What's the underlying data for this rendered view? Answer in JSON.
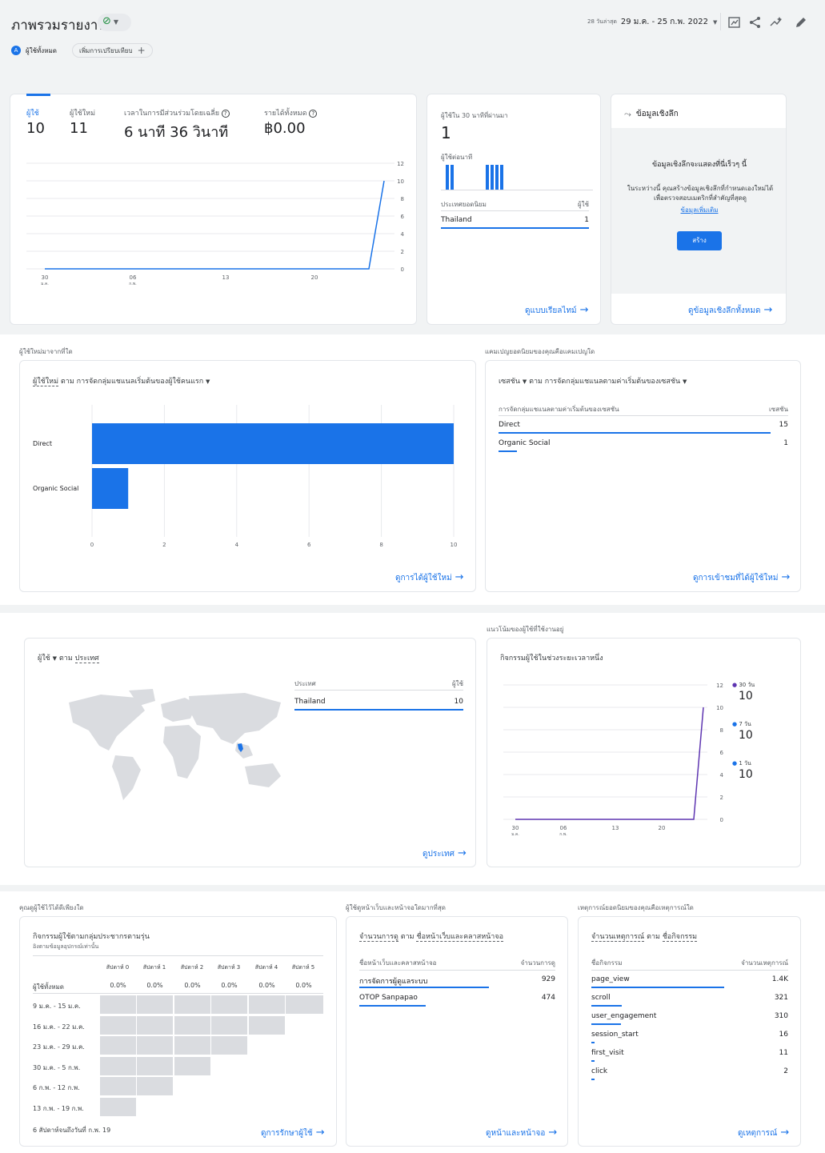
{
  "header": {
    "title": "ภาพรวมรายงาน",
    "date_prefix": "28 วันล่าสุด",
    "date_range": "29 ม.ค. - 25 ก.พ. 2022",
    "all_users_chip": "ผู้ใช้ทั้งหมด",
    "chip_letter": "A",
    "add_compare": "เพิ่มการเปรียบเทียบ"
  },
  "overview": {
    "metrics": [
      {
        "label": "ผู้ใช้",
        "value": "10"
      },
      {
        "label": "ผู้ใช้ใหม่",
        "value": "11"
      },
      {
        "label": "เวลาในการมีส่วนร่วมโดยเฉลี่ย",
        "value": "6 นาที 36 วินาที"
      },
      {
        "label": "รายได้ทั้งหมด",
        "value": "฿0.00"
      }
    ],
    "y_ticks": [
      "12",
      "10",
      "8",
      "6",
      "4",
      "2",
      "0"
    ],
    "x_ticks": [
      {
        "d": "30",
        "m": "ม.ค."
      },
      {
        "d": "06",
        "m": "ก.พ."
      },
      {
        "d": "13",
        "m": ""
      },
      {
        "d": "20",
        "m": ""
      }
    ]
  },
  "realtime": {
    "title": "ผู้ใช้ใน 30 นาทีที่ผ่านมา",
    "value": "1",
    "per_minute": "ผู้ใช้ต่อนาที",
    "col_country": "ประเทศยอดนิยม",
    "col_users": "ผู้ใช้",
    "row_country": "Thailand",
    "row_value": "1",
    "link": "ดูแบบเรียลไทม์"
  },
  "insights": {
    "title": "ข้อมูลเชิงลึก",
    "heading": "ข้อมูลเชิงลึกจะแสดงที่นี่เร็วๆ นี้",
    "body": "ในระหว่างนี้ คุณสร้างข้อมูลเชิงลึกที่กำหนดเองใหม่ได้เพื่อตรวจสอบเมตริกที่สำคัญที่สุดดู",
    "more": "ข้อมูลเพิ่มเติม",
    "button": "สร้าง",
    "link": "ดูข้อมูลเชิงลึกทั้งหมด"
  },
  "new_users": {
    "section": "ผู้ใช้ใหม่มาจากที่ใด",
    "metric": "ผู้ใช้ใหม่",
    "by": "ตาม การจัดกลุ่มแชแนลเริ่มต้นของผู้ใช้คนแรก",
    "link": "ดูการได้ผู้ใช้ใหม่",
    "x_ticks": [
      "0",
      "2",
      "4",
      "6",
      "8",
      "10"
    ]
  },
  "campaigns": {
    "section": "แคมเปญยอดนิยมของคุณคือแคมเปญใด",
    "metric": "เซสชัน",
    "by": "ตาม การจัดกลุ่มแชแนลตามค่าเริ่มต้นของเซสชัน",
    "col_left": "การจัดกลุ่มแชแนลตามค่าเริ่มต้นของเซสชัน",
    "col_right": "เซสชัน",
    "rows": [
      {
        "name": "Direct",
        "value": "15",
        "frac": 1.0
      },
      {
        "name": "Organic Social",
        "value": "1",
        "frac": 0.067
      }
    ],
    "link": "ดูการเข้าชมที่ได้ผู้ใช้ใหม่"
  },
  "countries": {
    "metric": "ผู้ใช้",
    "by": "ตาม",
    "dim": "ประเทศ",
    "col_country": "ประเทศ",
    "col_users": "ผู้ใช้",
    "row_country": "Thailand",
    "row_value": "10",
    "link": "ดูประเทศ"
  },
  "trends": {
    "section": "แนวโน้มของผู้ใช้ที่ใช้งานอยู่",
    "title": "กิจกรรมผู้ใช้ในช่วงระยะเวลาหนึ่ง",
    "y_ticks": [
      "12",
      "10",
      "8",
      "6",
      "4",
      "2",
      "0"
    ],
    "x_ticks": [
      {
        "d": "30",
        "m": "ม.ค."
      },
      {
        "d": "06",
        "m": "ก.พ."
      },
      {
        "d": "13",
        "m": ""
      },
      {
        "d": "20",
        "m": ""
      }
    ],
    "legend": [
      {
        "label": "30 วัน",
        "value": "10",
        "color": "#5e35b1"
      },
      {
        "label": "7 วัน",
        "value": "10",
        "color": "#1a73e8"
      },
      {
        "label": "1 วัน",
        "value": "10",
        "color": "#1a73e8"
      }
    ]
  },
  "retention": {
    "section": "คุณดูผู้ใช้ไว้ได้ดีเพียงใด",
    "title": "กิจกรรมผู้ใช้ตามกลุ่มประชากรตามรุ่น",
    "subtitle": "อิงตามข้อมูลอุปกรณ์เท่านั้น",
    "weeks": [
      "สัปดาห์ 0",
      "สัปดาห์ 1",
      "สัปดาห์ 2",
      "สัปดาห์ 3",
      "สัปดาห์ 4",
      "สัปดาห์ 5"
    ],
    "all_label": "ผู้ใช้ทั้งหมด",
    "all_values": [
      "0.0%",
      "0.0%",
      "0.0%",
      "0.0%",
      "0.0%",
      "0.0%"
    ],
    "cohorts": [
      "9 ม.ค. - 15 ม.ค.",
      "16 ม.ค. - 22 ม.ค.",
      "23 ม.ค. - 29 ม.ค.",
      "30 ม.ค. - 5 ก.พ.",
      "6 ก.พ. - 12 ก.พ.",
      "13 ก.พ. - 19 ก.พ."
    ],
    "footer": "6 สัปดาห์จนถึงวันที่ ก.พ. 19",
    "link": "ดูการรักษาผู้ใช้"
  },
  "pages": {
    "section": "ผู้ใช้ดูหน้าเว็บและหน้าจอใดมากที่สุด",
    "metric": "จำนวนการดู",
    "by": "ตาม",
    "dim": "ชื่อหน้าเว็บและคลาสหน้าจอ",
    "col_left": "ชื่อหน้าเว็บและคลาสหน้าจอ",
    "col_right": "จำนวนการดู",
    "rows": [
      {
        "name": "การจัดการผู้ดูแลระบบ",
        "value": "929",
        "frac": 1.0
      },
      {
        "name": "OTOP Sanpapao",
        "value": "474",
        "frac": 0.51
      }
    ],
    "link": "ดูหน้าและหน้าจอ"
  },
  "events": {
    "section": "เหตุการณ์ยอดนิยมของคุณคือเหตุการณ์ใด",
    "metric": "จำนวนเหตุการณ์",
    "by": "ตาม",
    "dim": "ชื่อกิจกรรม",
    "col_left": "ชื่อกิจกรรม",
    "col_right": "จำนวนเหตุการณ์",
    "rows": [
      {
        "name": "page_view",
        "value": "1.4K",
        "frac": 1.0
      },
      {
        "name": "scroll",
        "value": "321",
        "frac": 0.23
      },
      {
        "name": "user_engagement",
        "value": "310",
        "frac": 0.22
      },
      {
        "name": "session_start",
        "value": "16",
        "frac": 0.012
      },
      {
        "name": "first_visit",
        "value": "11",
        "frac": 0.008
      },
      {
        "name": "click",
        "value": "2",
        "frac": 0.0015
      }
    ],
    "link": "ดูเหตุการณ์"
  },
  "chart_data": [
    {
      "type": "line",
      "title": "ผู้ใช้",
      "x": [
        "30 ม.ค.",
        "06 ก.พ.",
        "13",
        "20",
        "24",
        "25"
      ],
      "series": [
        {
          "name": "ผู้ใช้",
          "values": [
            0,
            0,
            0,
            0,
            0,
            10
          ]
        }
      ],
      "ylim": [
        0,
        12
      ]
    },
    {
      "type": "bar",
      "title": "ผู้ใช้ต่อนาที",
      "categories": [
        "1",
        "2",
        "3",
        "4",
        "5",
        "6",
        "7"
      ],
      "values": [
        1,
        1,
        0,
        1,
        1,
        1,
        1
      ]
    },
    {
      "type": "bar",
      "orientation": "horizontal",
      "title": "ผู้ใช้ใหม่ ตาม การจัดกลุ่มแชแนลเริ่มต้นของผู้ใช้คนแรก",
      "categories": [
        "Direct",
        "Organic Social"
      ],
      "values": [
        10,
        1
      ],
      "xlim": [
        0,
        10
      ]
    },
    {
      "type": "line",
      "title": "กิจกรรมผู้ใช้ในช่วงระยะเวลาหนึ่ง",
      "x": [
        "30 ม.ค.",
        "06 ก.พ.",
        "13",
        "20",
        "24",
        "25"
      ],
      "series": [
        {
          "name": "30 วัน",
          "values": [
            0,
            0,
            0,
            0,
            0,
            10
          ]
        },
        {
          "name": "7 วัน",
          "values": [
            0,
            0,
            0,
            0,
            0,
            10
          ]
        },
        {
          "name": "1 วัน",
          "values": [
            0,
            0,
            0,
            0,
            0,
            10
          ]
        }
      ],
      "ylim": [
        0,
        12
      ]
    }
  ]
}
